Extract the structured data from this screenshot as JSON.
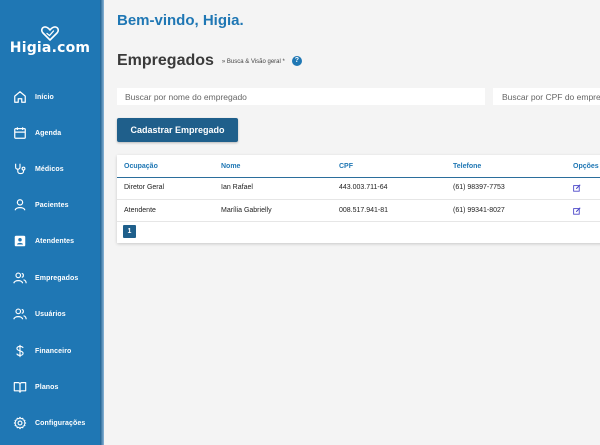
{
  "app": {
    "name": "Higia.com"
  },
  "sidebar": {
    "items": [
      {
        "label": "Início",
        "icon": "home-icon"
      },
      {
        "label": "Agenda",
        "icon": "calendar-icon"
      },
      {
        "label": "Médicos",
        "icon": "stethoscope-icon"
      },
      {
        "label": "Pacientes",
        "icon": "user-icon"
      },
      {
        "label": "Atendentes",
        "icon": "id-badge-icon"
      },
      {
        "label": "Empregados",
        "icon": "users-icon"
      },
      {
        "label": "Usuários",
        "icon": "users-icon"
      },
      {
        "label": "Financeiro",
        "icon": "dollar-icon"
      },
      {
        "label": "Planos",
        "icon": "book-icon"
      },
      {
        "label": "Configurações",
        "icon": "gear-icon"
      }
    ]
  },
  "main": {
    "welcome": "Bem-vindo, Higia.",
    "section_title": "Empregados",
    "section_subtitle": "» Busca & Visão geral *",
    "search_name_placeholder": "Buscar por nome do empregado",
    "search_cpf_placeholder": "Buscar por CPF do empre",
    "register_button": "Cadastrar Empregado"
  },
  "table": {
    "headers": [
      "Ocupação",
      "Nome",
      "CPF",
      "Telefone",
      "Opções"
    ],
    "rows": [
      {
        "ocupacao": "Diretor Geral",
        "nome": "Ian Rafael",
        "cpf": "443.003.711-64",
        "telefone": "(61) 98397-7753"
      },
      {
        "ocupacao": "Atendente",
        "nome": "Marília Gabrielly",
        "cpf": "008.517.941-81",
        "telefone": "(61) 99341-8027"
      }
    ]
  },
  "pagination": {
    "current": "1"
  },
  "colors": {
    "primary": "#1f77b4",
    "button": "#1f5f8b",
    "background": "#f4f4f4"
  }
}
